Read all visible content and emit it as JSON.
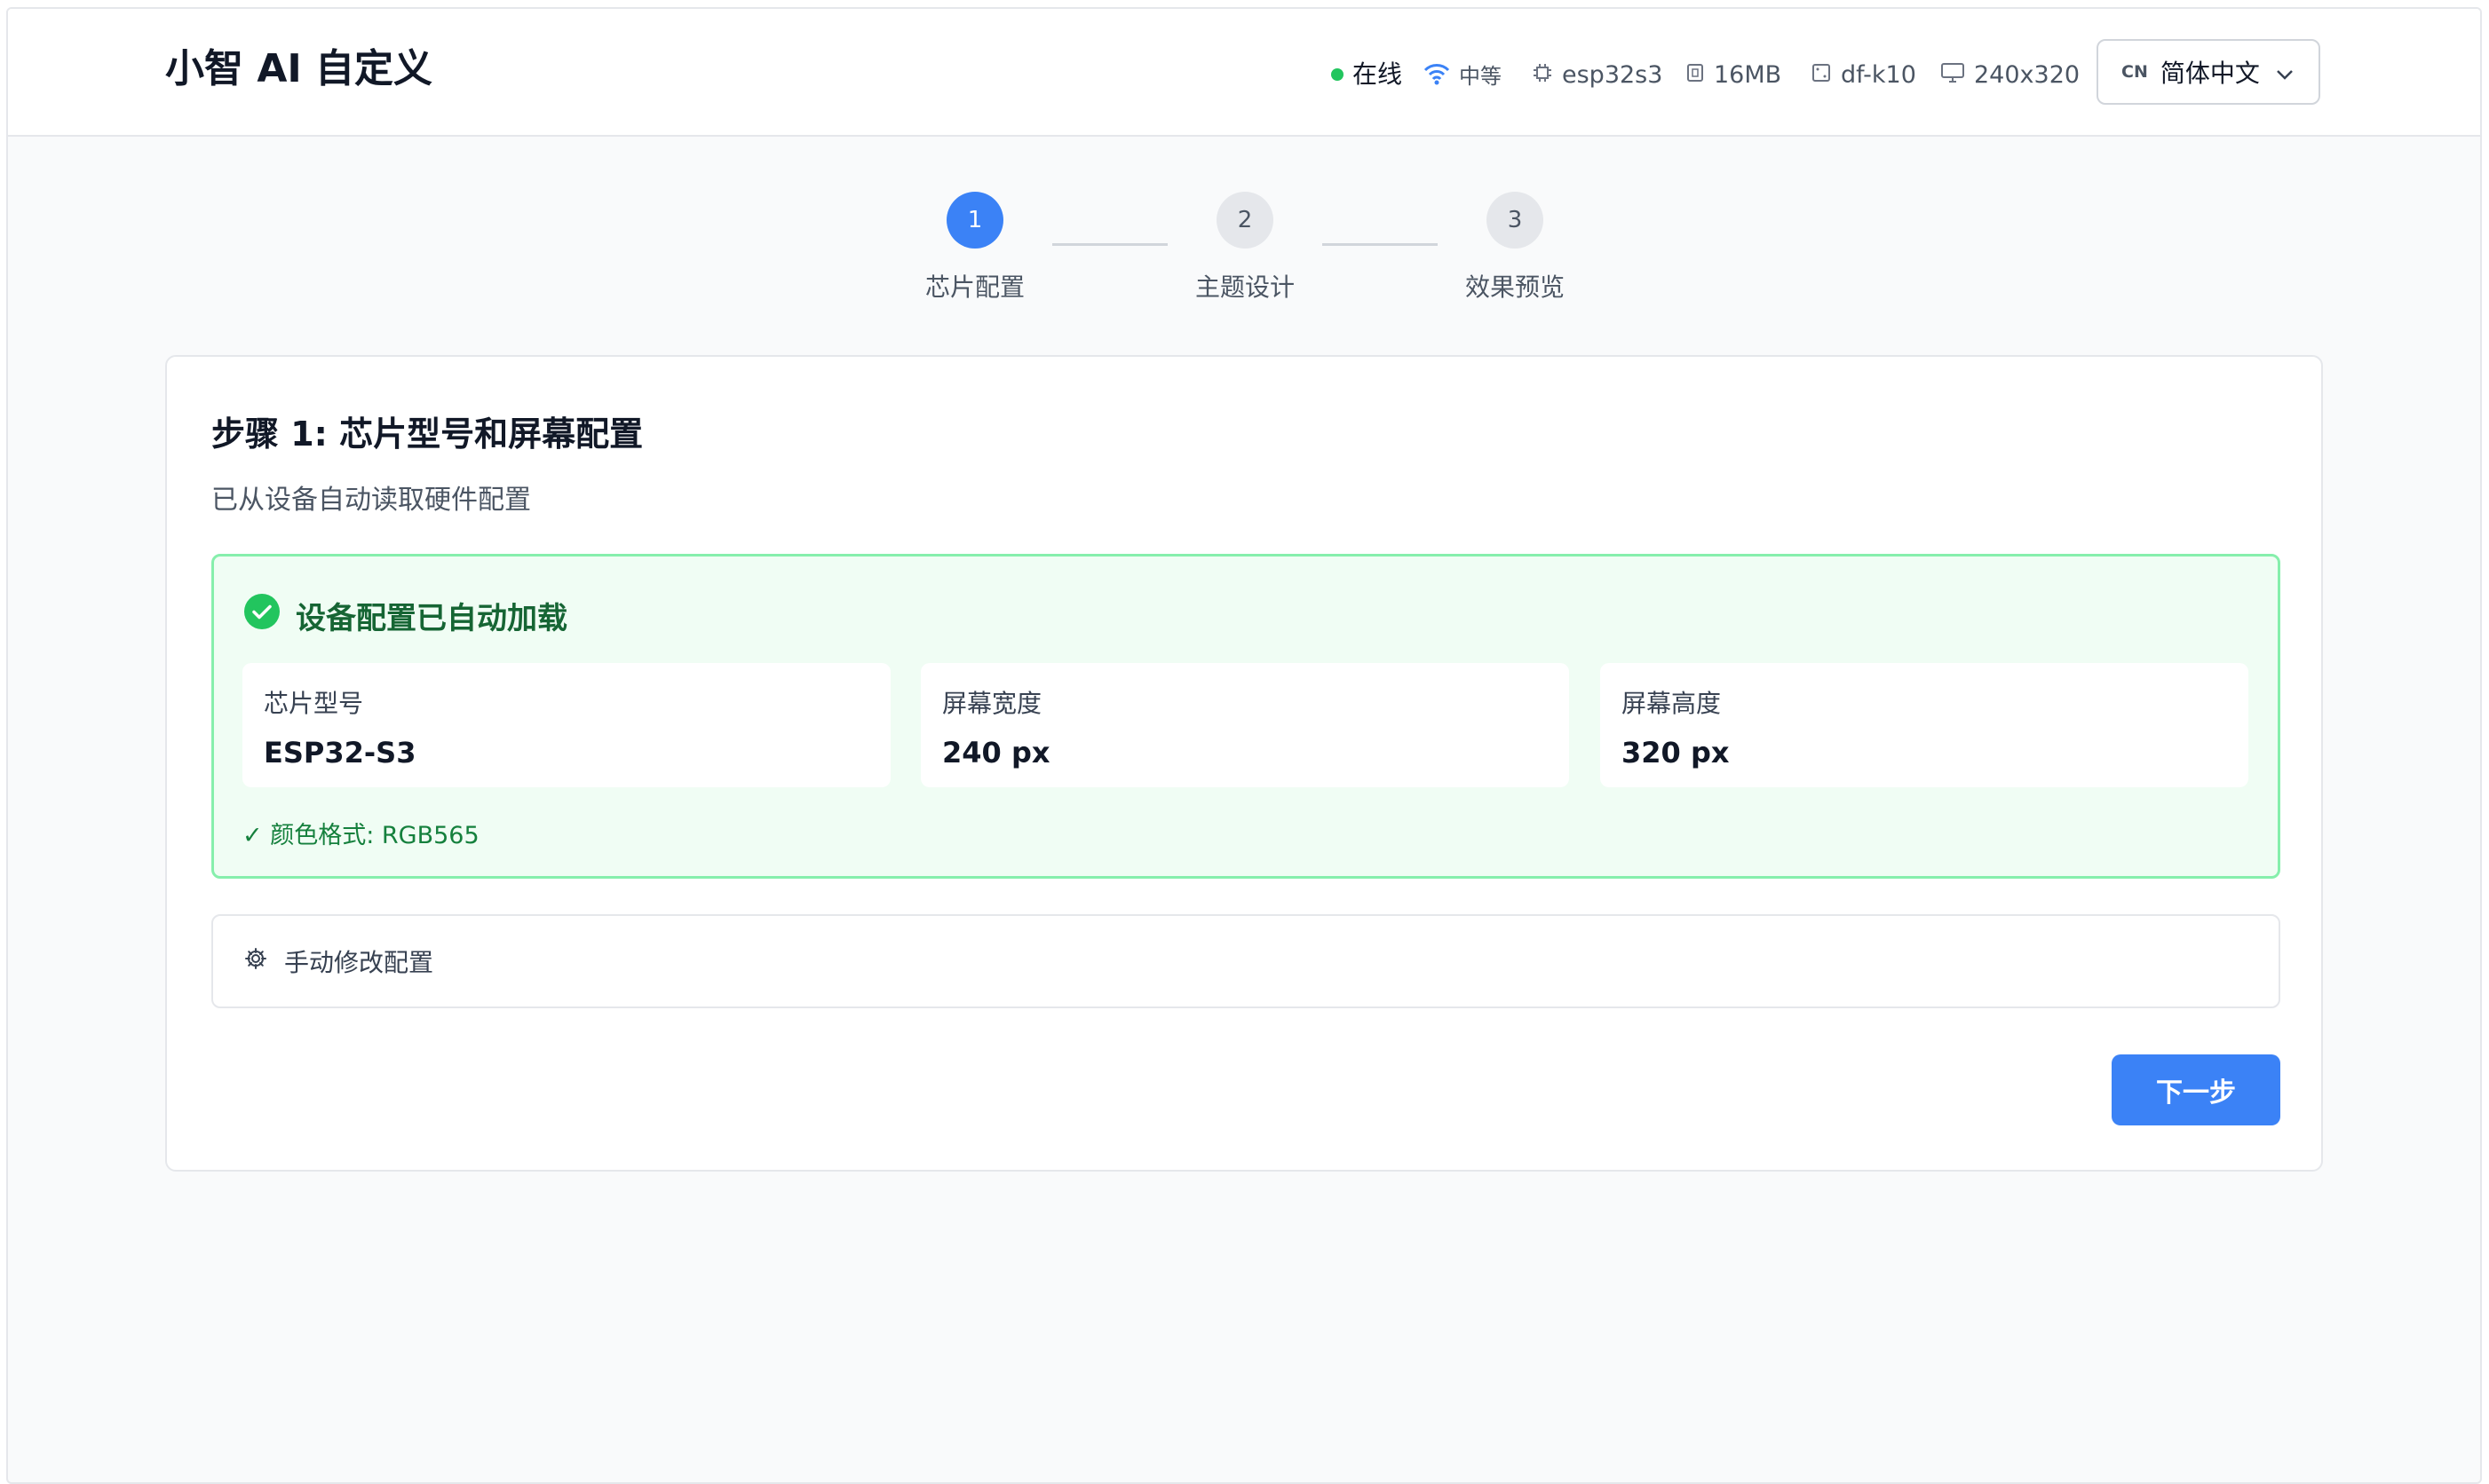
{
  "header": {
    "app_title": "小智 AI 自定义",
    "status": {
      "online": "在线",
      "signal": "中等",
      "chip": "esp32s3",
      "flash": "16MB",
      "board": "df-k10",
      "resolution": "240x320"
    },
    "language": {
      "code": "CN",
      "label": "简体中文"
    }
  },
  "steps": [
    {
      "number": "1",
      "label": "芯片配置",
      "active": true
    },
    {
      "number": "2",
      "label": "主题设计",
      "active": false
    },
    {
      "number": "3",
      "label": "效果预览",
      "active": false
    }
  ],
  "card": {
    "title": "步骤 1: 芯片型号和屏幕配置",
    "subtitle": "已从设备自动读取硬件配置",
    "success": {
      "heading": "设备配置已自动加载",
      "fields": [
        {
          "label": "芯片型号",
          "value": "ESP32-S3"
        },
        {
          "label": "屏幕宽度",
          "value": "240 px"
        },
        {
          "label": "屏幕高度",
          "value": "320 px"
        }
      ],
      "color_format": "✓ 颜色格式: RGB565"
    },
    "manual_label": "手动修改配置",
    "next_label": "下一步"
  },
  "colors": {
    "accent": "#3b82f6",
    "online": "#22c55e",
    "success_bg": "#f0fdf4",
    "success_border": "#86efac",
    "success_text": "#166534"
  }
}
